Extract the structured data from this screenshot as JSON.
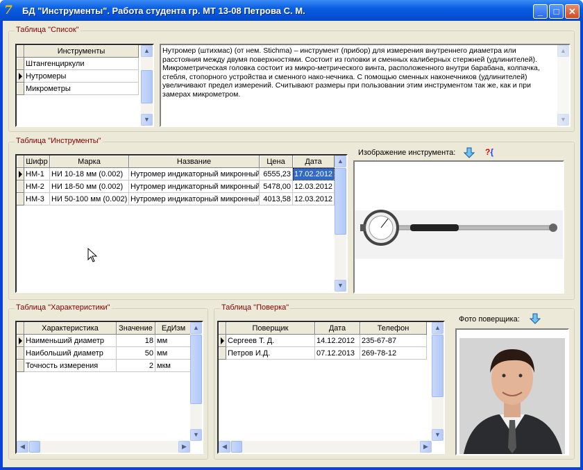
{
  "window": {
    "title": "БД \"Инструменты\". Работа студента гр. МТ 13-08 Петрова С. М.",
    "icon": "delphi-app-icon",
    "controls": [
      "minimize",
      "maximize",
      "close"
    ]
  },
  "list_group": {
    "caption": "Таблица \"Список\"",
    "header": "Инструменты",
    "items": [
      "Штангенциркули",
      "Нутромеры",
      "Микрометры"
    ],
    "current_index": 1,
    "description": "Нутромер (штихмас) (от нем. Stichma) – инструмент (прибор) для измерения внутреннего диаметра или расстояния между двумя поверхностями. Состоит из головки и сменных калиберных стержней (удлинителей). Микрометрическая головка состоит из микро-метрического винта, расположенного внутри барабана, колпачка, стебля, стопорного устройства и сменного нако-нечника. С помощью сменных наконечников (удлинителей) увеличивают предел измерений. Считывают размеры при пользовании этим инструментом так же, как и при замерах микрометром."
  },
  "instruments_group": {
    "caption": "Таблица \"Инструменты\"",
    "columns": [
      "Шифр",
      "Марка",
      "Название",
      "Цена",
      "Дата"
    ],
    "rows": [
      [
        "НМ-1",
        "НИ 10-18 мм (0.002)",
        "Нутромер индикаторный микронный",
        "6555,23",
        "17.02.2012"
      ],
      [
        "НМ-2",
        "НИ 18-50 мм (0.002)",
        "Нутромер индикаторный микронный",
        "5478,00",
        "12.03.2012"
      ],
      [
        "НМ-3",
        "НИ 50-100 мм (0.002)",
        "Нутромер индикаторный микронный",
        "4013,58",
        "12.03.2012"
      ]
    ],
    "image_label": "Изображение инструмента:",
    "help_icon_text": "?{"
  },
  "specs_group": {
    "caption": "Таблица \"Характеристики\"",
    "columns": [
      "Характеристика",
      "Значение",
      "ЕдИзм"
    ],
    "rows": [
      [
        "Наименьший диаметр",
        "18",
        "мм"
      ],
      [
        "Наибольший диаметр",
        "50",
        "мм"
      ],
      [
        "Точность измерения",
        "2",
        "мкм"
      ]
    ]
  },
  "verify_group": {
    "caption": "Таблица \"Поверка\"",
    "columns": [
      "Поверщик",
      "Дата",
      "Телефон"
    ],
    "rows": [
      [
        "Сергеев Т. Д.",
        "14.12.2012",
        "235-67-87"
      ],
      [
        "Петров И.Д.",
        "07.12.2013",
        "269-78-12"
      ]
    ],
    "photo_label": "Фото поверщика:"
  }
}
